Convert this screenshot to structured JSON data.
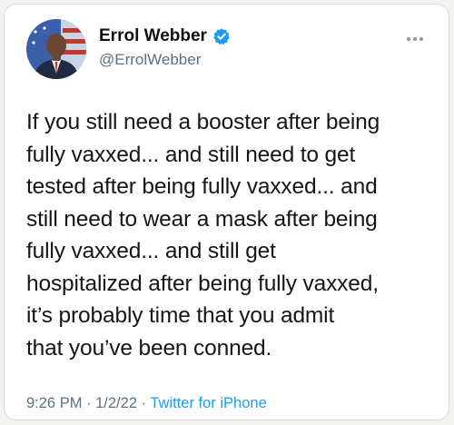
{
  "tweet": {
    "author_name": "Errol Webber",
    "handle": "@ErrolWebber",
    "verified": true,
    "body_lines": [
      "If you still need a booster after being",
      "fully vaxxed... and still need to get",
      "tested after being fully vaxxed... and",
      "still need to wear a mask after being",
      "fully vaxxed... and still get",
      "hospitalized after being fully vaxxed,",
      "it’s probably time that you admit",
      "that you’ve been conned."
    ],
    "time": "9:26 PM",
    "separator": " · ",
    "date": "1/2/22",
    "source": "Twitter for iPhone"
  },
  "colors": {
    "verified_badge": "#1d9bf0",
    "link": "#1d9bf0",
    "secondary_text": "#5b7083",
    "primary_text": "#161616"
  },
  "icons": {
    "verified": "verified-badge-icon",
    "more": "more-options-icon"
  }
}
